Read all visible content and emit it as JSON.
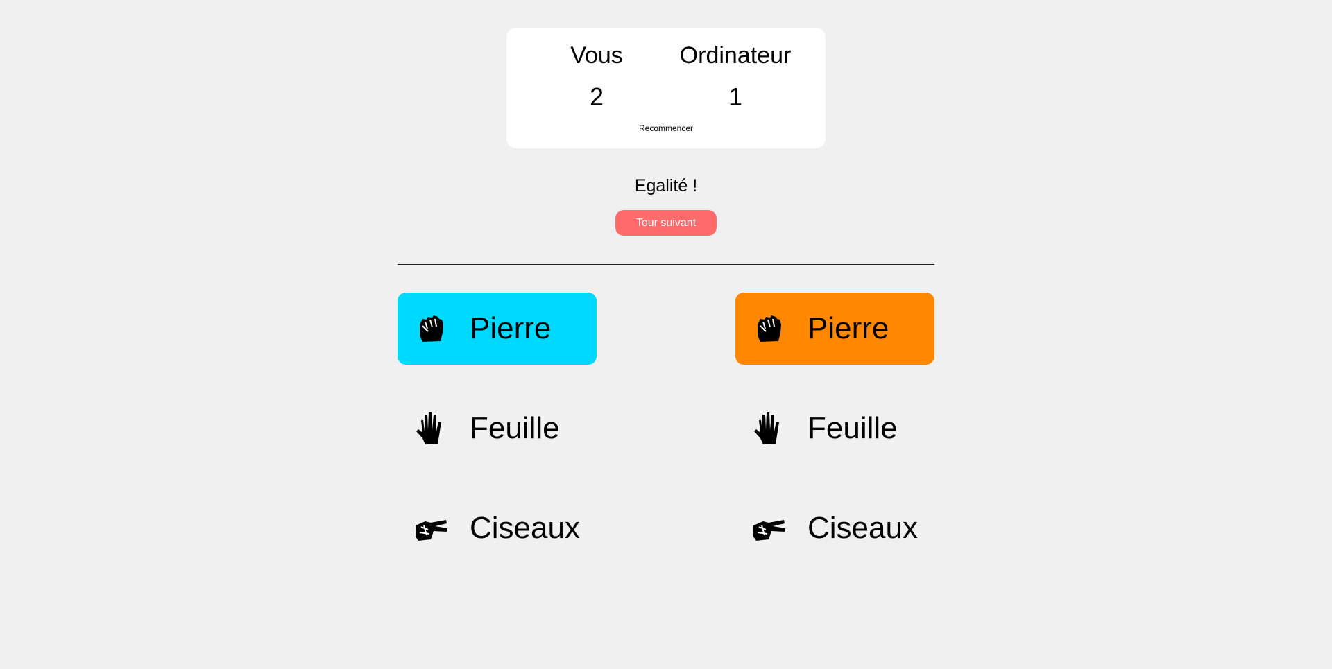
{
  "scoreboard": {
    "player_label": "Vous",
    "computer_label": "Ordinateur",
    "player_score": "2",
    "computer_score": "1",
    "restart_label": "Recommencer"
  },
  "round": {
    "result_text": "Egalité !",
    "next_button_label": "Tour suivant"
  },
  "player_choices": [
    {
      "label": "Pierre",
      "icon": "fist-icon",
      "selected": true
    },
    {
      "label": "Feuille",
      "icon": "hand-icon",
      "selected": false
    },
    {
      "label": "Ciseaux",
      "icon": "scissors-hand-icon",
      "selected": false
    }
  ],
  "computer_choices": [
    {
      "label": "Pierre",
      "icon": "fist-icon",
      "selected": true
    },
    {
      "label": "Feuille",
      "icon": "hand-icon",
      "selected": false
    },
    {
      "label": "Ciseaux",
      "icon": "scissors-hand-icon",
      "selected": false
    }
  ],
  "colors": {
    "background": "#f0f0f0",
    "player_selected": "#00d9ff",
    "computer_selected": "#ff8800",
    "next_button": "#ff6b6b"
  }
}
